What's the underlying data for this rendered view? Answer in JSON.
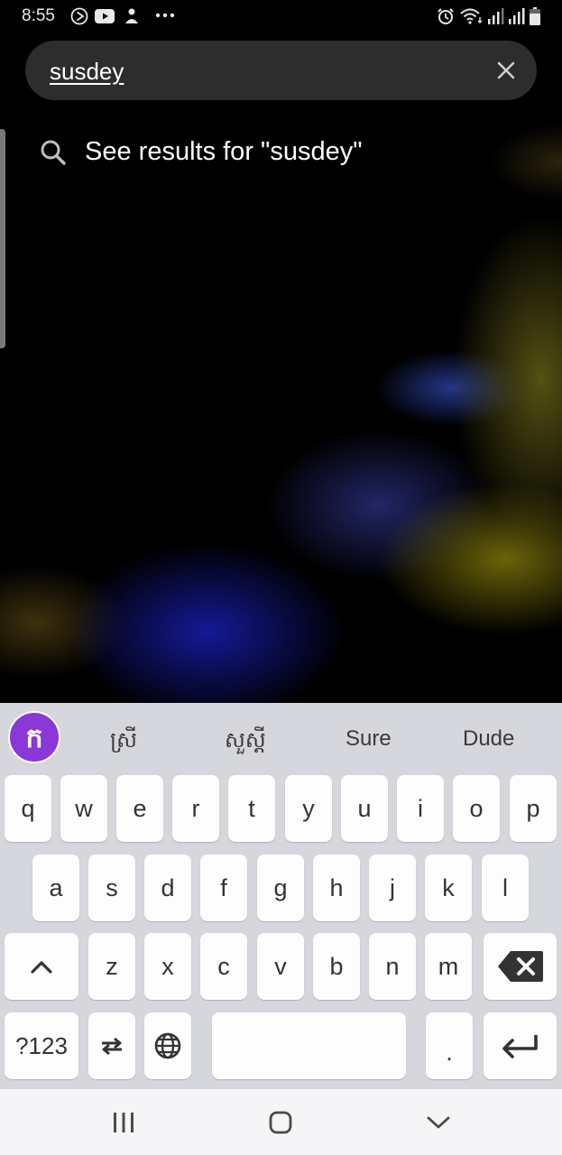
{
  "status_bar": {
    "time": "8:55",
    "left_icons": [
      "play-circle-icon",
      "youtube-icon",
      "person-icon",
      "more-dots-icon"
    ],
    "right_icons": [
      "alarm-icon",
      "wifi-icon",
      "signal-icon",
      "signal-icon",
      "battery-icon"
    ]
  },
  "search": {
    "query": "susdey",
    "clear_icon": "close-icon"
  },
  "suggestion": {
    "icon": "search-icon",
    "text": "See results for \"susdey\""
  },
  "keyboard": {
    "logo_glyph": "ក",
    "suggestions": [
      "ស្រី",
      "សួស្តី",
      "Sure",
      "Dude"
    ],
    "row1": [
      "q",
      "w",
      "e",
      "r",
      "t",
      "y",
      "u",
      "i",
      "o",
      "p"
    ],
    "row2": [
      "a",
      "s",
      "d",
      "f",
      "g",
      "h",
      "j",
      "k",
      "l"
    ],
    "row3": [
      "z",
      "x",
      "c",
      "v",
      "b",
      "n",
      "m"
    ],
    "symbols_label": "?123",
    "period_label": ".",
    "colors": {
      "background": "#d5d7dc",
      "key": "#fdfdfd",
      "logo": "#8a38d8"
    }
  },
  "navbar": {
    "icons": [
      "recent-apps-icon",
      "home-icon",
      "back-chevron-icon"
    ]
  }
}
